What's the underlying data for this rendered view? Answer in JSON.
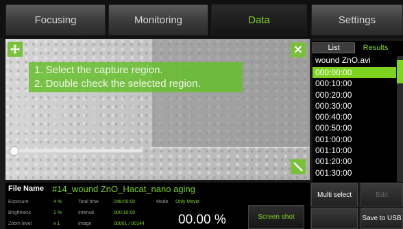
{
  "tabs": [
    "Focusing",
    "Monitoring",
    "Data",
    "Settings"
  ],
  "viewer": {
    "instructions": [
      "1. Select the capture region.",
      "2. Double check the selected region."
    ],
    "close_glyph": "✕",
    "slider_position": 0.02
  },
  "results_panel": {
    "tab_list": "List",
    "tab_results": "Results",
    "file": "wound ZnO.avi",
    "times": [
      "000:00:00",
      "000:10:00",
      "000:20:00",
      "000:30:00",
      "000:40:00",
      "000:50:00",
      "001:00:00",
      "001:10:00",
      "001:20:00",
      "001:30:00"
    ],
    "selected_index": 0
  },
  "info": {
    "file_name_label": "File Name",
    "file_name_value": "#14_wound ZnO_Hacat_nano aging",
    "exposure_label": "Exposure",
    "exposure_value": "4 %",
    "brightness_label": "Brightness",
    "brightness_value": "1 %",
    "zoom_label": "Zoom level",
    "zoom_value": "x 1",
    "total_time_label": "Total time",
    "total_time_value": "048:00:00",
    "interval_label": "Interval",
    "interval_value": "000:10:00",
    "image_label": "Image",
    "image_value": "00001 / 00144",
    "mode_label": "Mode",
    "mode_value": "Only Movie",
    "progress": "00.00 %"
  },
  "buttons": {
    "screenshot": "Screen shot",
    "multi_select": "Multi select",
    "edit": "Edit",
    "save_to_usb": "Save to USB"
  },
  "colors": {
    "accent": "#7ed321"
  }
}
